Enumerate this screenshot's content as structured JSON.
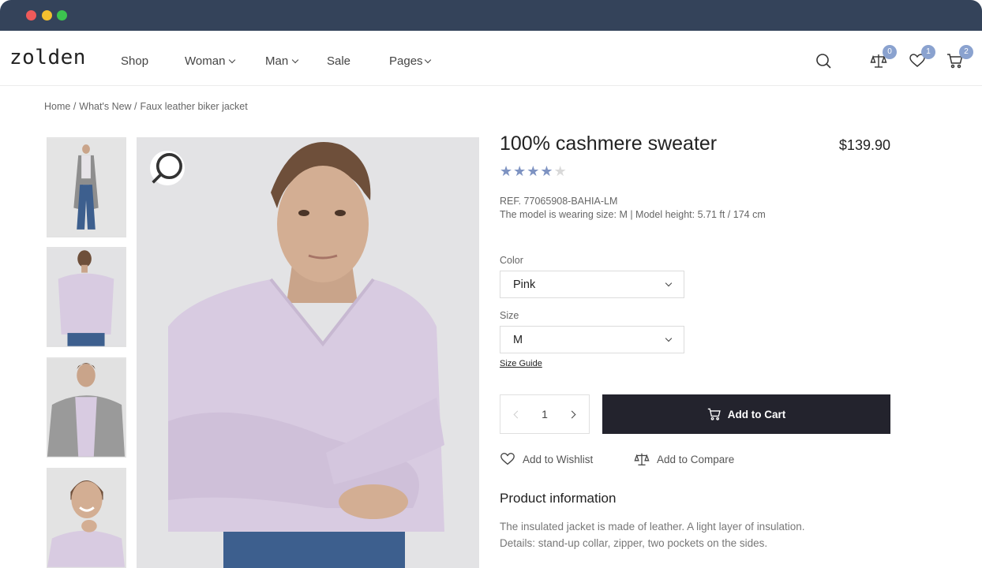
{
  "brand": {
    "logo": "zolden"
  },
  "nav": {
    "items": [
      {
        "label": "Shop",
        "dropdown": false
      },
      {
        "label": "Woman",
        "dropdown": true
      },
      {
        "label": "Man",
        "dropdown": true
      },
      {
        "label": "Sale",
        "dropdown": false
      },
      {
        "label": "Pages",
        "dropdown": true
      }
    ]
  },
  "header_icons": {
    "search": "search-icon",
    "compare": {
      "icon": "scale-icon",
      "count": "0"
    },
    "wishlist": {
      "icon": "heart-icon",
      "count": "1"
    },
    "cart": {
      "icon": "cart-icon",
      "count": "2"
    }
  },
  "breadcrumb": [
    "Home /",
    "What's New /",
    "Faux leather biker jacket"
  ],
  "product": {
    "title": "100% cashmere sweater",
    "price": "$139.90",
    "rating": 4,
    "rating_max": 5,
    "ref": "REF. 77065908-BAHIA-LM",
    "model_info": "The model is wearing size: M | Model height: 5.71 ft / 174 cm",
    "color_label": "Color",
    "color_value": "Pink",
    "size_label": "Size",
    "size_value": "M",
    "size_guide": "Size Guide",
    "quantity": "1",
    "add_to_cart": "Add to Cart",
    "add_to_wishlist": "Add to Wishlist",
    "add_to_compare": "Add to Compare",
    "info_title": "Product information",
    "info_line1": "The insulated jacket is made of leather. A light layer of insulation.",
    "info_line2": "Details: stand-up collar, zipper, two pockets on the sides."
  },
  "colors": {
    "chrome": "#34435a",
    "accent": "#7e93c2",
    "button": "#23232d",
    "sweater": "#d8cbe1"
  }
}
